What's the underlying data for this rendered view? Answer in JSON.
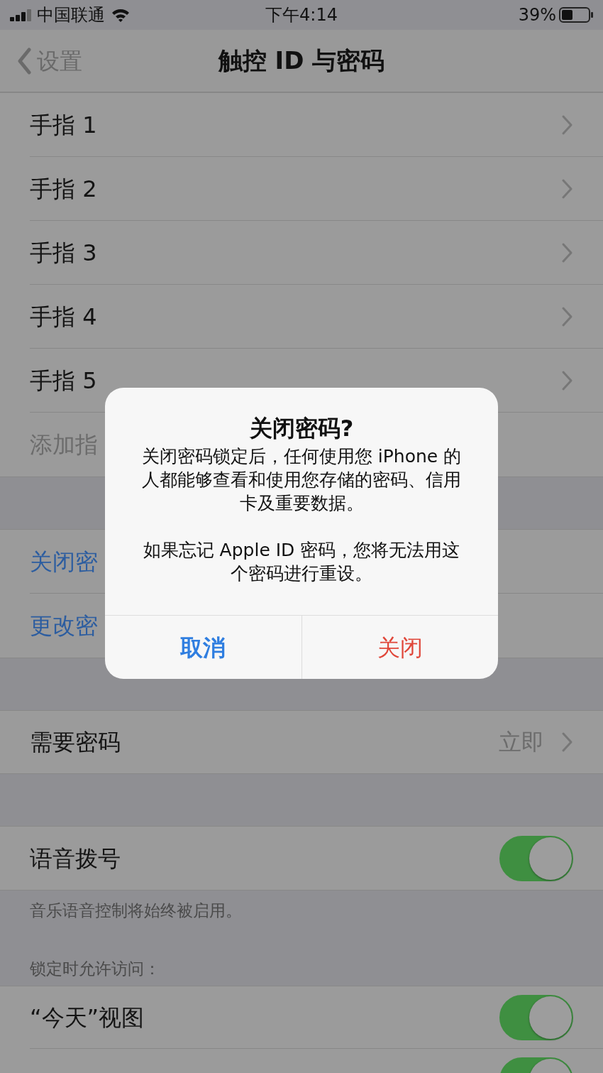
{
  "status_bar": {
    "carrier": "中国联通",
    "time": "下午4:14",
    "battery": "39%"
  },
  "nav": {
    "back": "设置",
    "title": "触控 ID 与密码"
  },
  "sections": [
    {
      "rows": [
        {
          "kind": "nav",
          "label": "手指 1"
        },
        {
          "kind": "nav",
          "label": "手指 2"
        },
        {
          "kind": "nav",
          "label": "手指 3"
        },
        {
          "kind": "nav",
          "label": "手指 4"
        },
        {
          "kind": "nav",
          "label": "手指 5"
        },
        {
          "kind": "add",
          "label": "添加指"
        }
      ]
    },
    {
      "rows": [
        {
          "kind": "action",
          "label": "关闭密"
        },
        {
          "kind": "action",
          "label": "更改密"
        }
      ]
    },
    {
      "rows": [
        {
          "kind": "value",
          "label": "需要密码",
          "value": "立即"
        }
      ]
    },
    {
      "rows": [
        {
          "kind": "toggle",
          "label": "语音拨号",
          "on": true
        }
      ],
      "footer": "音乐语音控制将始终被启用。"
    },
    {
      "header": "锁定时允许访问：",
      "rows": [
        {
          "kind": "toggle",
          "label": "“今天”视图",
          "on": true
        },
        {
          "kind": "toggle",
          "on": true
        }
      ]
    }
  ],
  "alert": {
    "title": "关闭密码?",
    "message": [
      "关闭密码锁定后，任何使用您 iPhone 的人都能够查看和使用您存储的密码、信用卡及重要数据。",
      "如果忘记 Apple ID 密码，您将无法用这个密码进行重设。"
    ],
    "buttons": [
      {
        "label": "取消",
        "kind": "cancel"
      },
      {
        "label": "关闭",
        "kind": "destructive"
      }
    ]
  }
}
